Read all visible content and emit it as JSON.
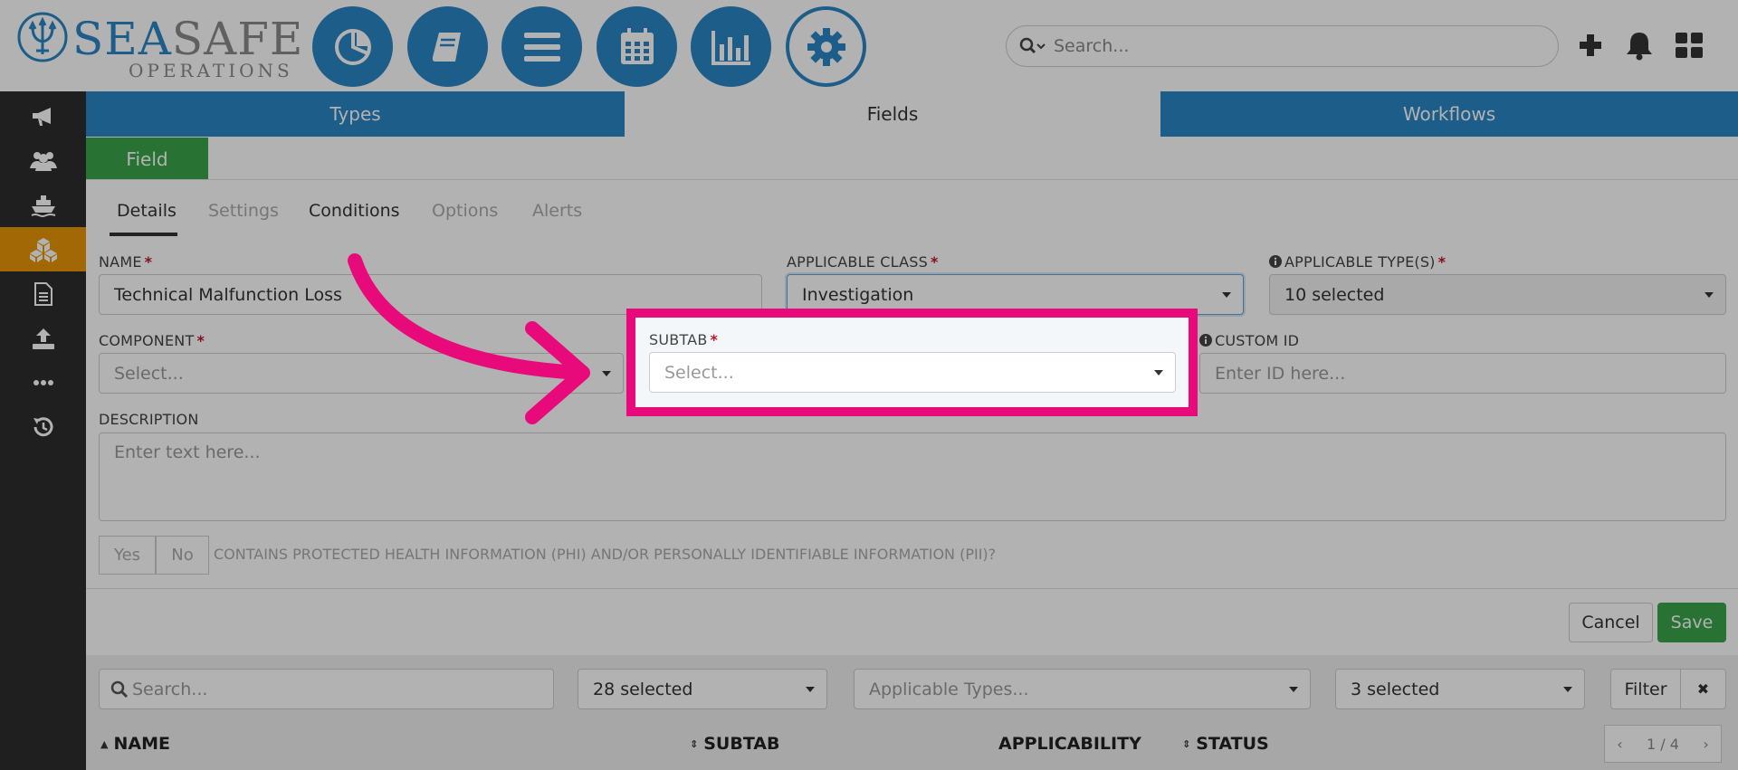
{
  "brand": {
    "name_part1": "SEA",
    "name_part2": "SAFE",
    "subtitle": "OPERATIONS"
  },
  "header": {
    "search_placeholder": "Search..."
  },
  "top_tabs": [
    {
      "label": "Types"
    },
    {
      "label": "Fields"
    },
    {
      "label": "Workflows"
    }
  ],
  "field_tab": "Field",
  "sub_tabs": [
    {
      "label": "Details"
    },
    {
      "label": "Settings"
    },
    {
      "label": "Conditions"
    },
    {
      "label": "Options"
    },
    {
      "label": "Alerts"
    }
  ],
  "form": {
    "name_label": "NAME",
    "name_value": "Technical Malfunction Loss",
    "class_label": "APPLICABLE CLASS",
    "class_value": "Investigation",
    "types_label": "APPLICABLE TYPE(S)",
    "types_value": "10 selected",
    "component_label": "COMPONENT",
    "component_placeholder": "Select...",
    "subtab_label": "SUBTAB",
    "subtab_placeholder": "Select...",
    "custom_id_label": "CUSTOM ID",
    "custom_id_placeholder": "Enter ID here...",
    "description_label": "DESCRIPTION",
    "description_placeholder": "Enter text here...",
    "yes_label": "Yes",
    "no_label": "No",
    "phi_label": "CONTAINS PROTECTED HEALTH INFORMATION (PHI) AND/OR PERSONALLY IDENTIFIABLE INFORMATION (PII)?",
    "required_mark": "*"
  },
  "actions": {
    "cancel": "Cancel",
    "save": "Save"
  },
  "list_filters": {
    "search_placeholder": "Search...",
    "sel1": "28 selected",
    "applicable_types_placeholder": "Applicable Types...",
    "sel3": "3 selected",
    "filter": "Filter",
    "clear": "✖"
  },
  "columns": [
    {
      "label": "NAME"
    },
    {
      "label": "SUBTAB"
    },
    {
      "label": "APPLICABILITY"
    },
    {
      "label": "STATUS"
    }
  ],
  "pager": {
    "prev": "‹",
    "text": "1 / 4",
    "next": "›"
  },
  "colors": {
    "brand_blue": "#2a86c6",
    "active_orange": "#e8960a",
    "green": "#3aa54a",
    "highlight": "#e8097b"
  }
}
